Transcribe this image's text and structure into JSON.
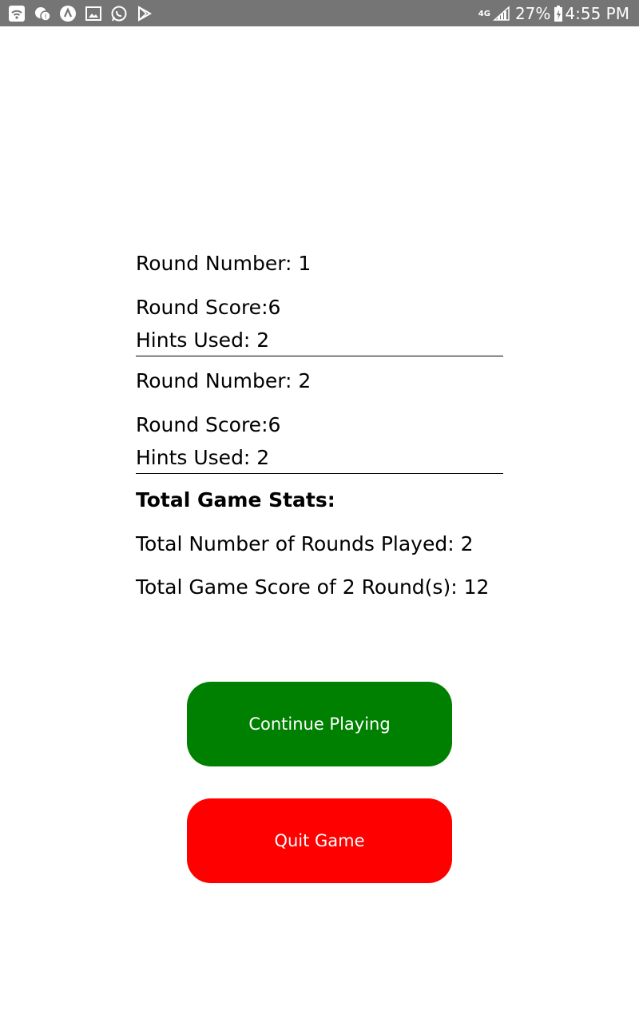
{
  "status_bar": {
    "network": "4G",
    "battery": "27%",
    "time": "4:55 PM",
    "left_icons": [
      "wifi-icon",
      "chat-bubble-icon",
      "app-a-icon",
      "image-icon",
      "whatsapp-icon",
      "play-store-icon"
    ]
  },
  "rounds": [
    {
      "number_label": "Round Number: 1",
      "score_label": "Round Score:6",
      "hints_label": "Hints Used: 2"
    },
    {
      "number_label": "Round Number: 2",
      "score_label": "Round Score:6",
      "hints_label": "Hints Used: 2"
    }
  ],
  "totals": {
    "heading": "Total Game Stats:",
    "rounds_played": "Total Number of Rounds Played: 2",
    "game_score": "Total Game Score of 2 Round(s): 12"
  },
  "buttons": {
    "continue_label": "Continue Playing",
    "quit_label": "Quit Game",
    "continue_color": "#008000",
    "quit_color": "#ff0000"
  }
}
